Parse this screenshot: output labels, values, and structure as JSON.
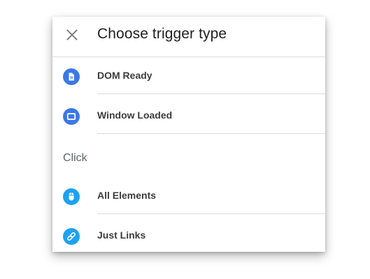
{
  "dialog": {
    "title": "Choose trigger type"
  },
  "page_load_items": [
    {
      "label": "DOM Ready",
      "icon": "document-icon",
      "color": "#3b78e7"
    },
    {
      "label": "Window Loaded",
      "icon": "window-icon",
      "color": "#3b78e7"
    }
  ],
  "click_section": {
    "heading": "Click",
    "items": [
      {
        "label": "All Elements",
        "icon": "mouse-icon",
        "color": "#1da1f2"
      },
      {
        "label": "Just Links",
        "icon": "link-icon",
        "color": "#1da1f2"
      }
    ]
  }
}
